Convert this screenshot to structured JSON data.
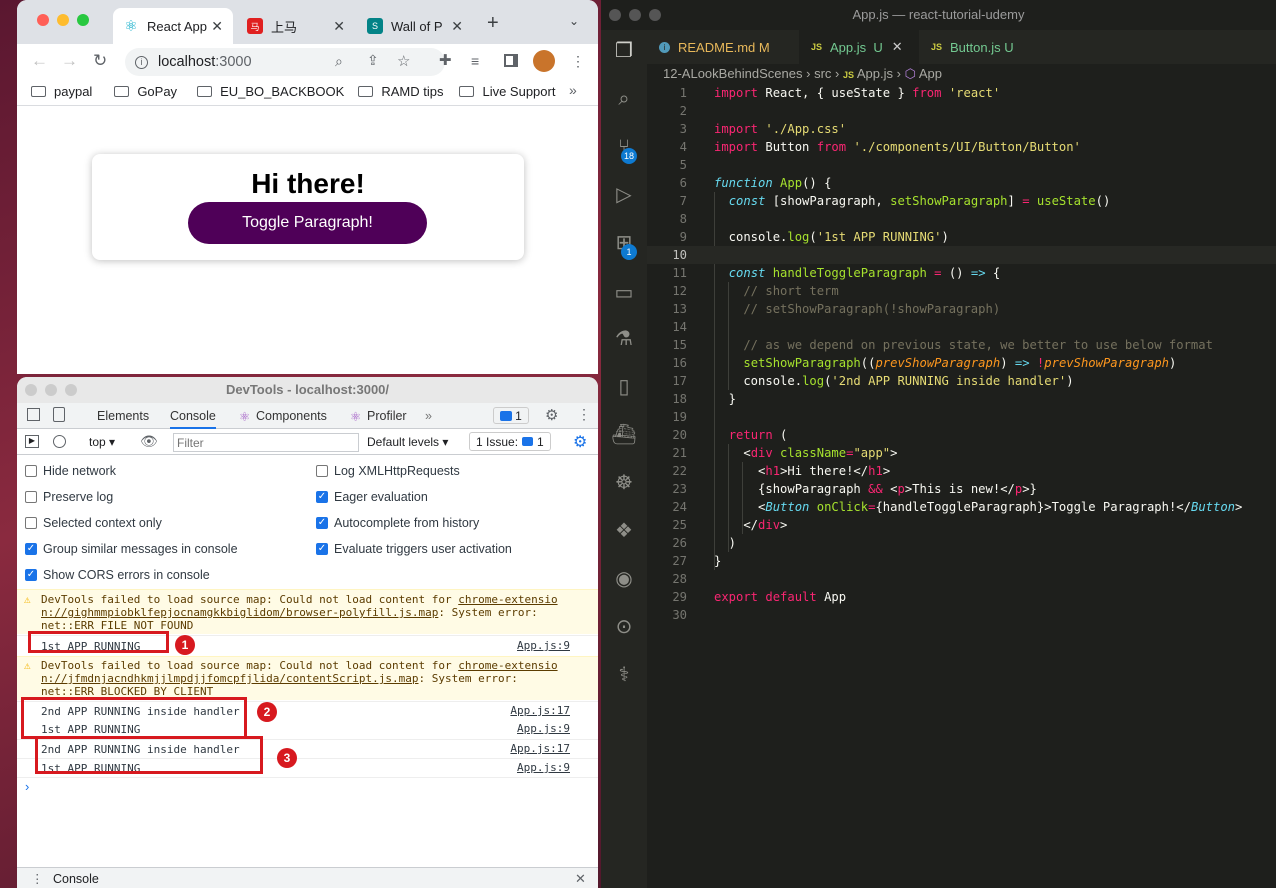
{
  "browser": {
    "tabs": [
      {
        "title": "React App",
        "active": true
      },
      {
        "title": "上马",
        "active": false
      },
      {
        "title": "Wall of Pr",
        "active": false
      }
    ],
    "url_host": "localhost",
    "url_port": ":3000",
    "bookmarks": [
      "paypal",
      "GoPay",
      "EU_BO_BACKBOOK",
      "RAMD tips",
      "Live Support"
    ],
    "page": {
      "heading": "Hi there!",
      "button_label": "Toggle Paragraph!"
    }
  },
  "devtools": {
    "title": "DevTools - localhost:3000/",
    "tabs": [
      "Elements",
      "Console",
      "Components",
      "Profiler"
    ],
    "messages_badge": "1",
    "context": "top",
    "filter_placeholder": "Filter",
    "levels": "Default levels",
    "issues": "1 Issue:",
    "issues_count": "1",
    "settings_left": [
      {
        "label": "Hide network",
        "checked": false
      },
      {
        "label": "Preserve log",
        "checked": false
      },
      {
        "label": "Selected context only",
        "checked": false
      },
      {
        "label": "Group similar messages in console",
        "checked": true
      },
      {
        "label": "Show CORS errors in console",
        "checked": true
      }
    ],
    "settings_right": [
      {
        "label": "Log XMLHttpRequests",
        "checked": false
      },
      {
        "label": "Eager evaluation",
        "checked": true
      },
      {
        "label": "Autocomplete from history",
        "checked": true
      },
      {
        "label": "Evaluate triggers user activation",
        "checked": true
      }
    ],
    "warn1": {
      "l1": "DevTools failed to load source map: Could not load content for ",
      "link1": "chrome-extensio",
      "link2": "n://gighmmpiobklfepjocnamgkkbiglidom/browser-polyfill.js.map",
      "rest": ": System error:",
      "l3": "net::ERR_FILE_NOT_FOUND"
    },
    "warn2": {
      "l1": "DevTools failed to load source map: Could not load content for ",
      "link1": "chrome-extensio",
      "link2": "n://jfmdnjacndhkmjjlmpdjjfomcpfjlida/contentScript.js.map",
      "rest": ": System error:",
      "l3": "net::ERR_BLOCKED_BY_CLIENT"
    },
    "logs": [
      {
        "text": "1st APP RUNNING",
        "src": "App.js:9"
      },
      {
        "text": "2nd APP RUNNING inside handler",
        "src": "App.js:17"
      },
      {
        "text": "1st APP RUNNING",
        "src": "App.js:9"
      },
      {
        "text": "2nd APP RUNNING inside handler",
        "src": "App.js:17"
      },
      {
        "text": "1st APP RUNNING",
        "src": "App.js:9"
      }
    ],
    "annotations": [
      "1",
      "2",
      "3"
    ],
    "drawer_label": "Console"
  },
  "vscode": {
    "title": "App.js — react-tutorial-udemy",
    "tabs": [
      {
        "name": "README.md",
        "status": "M"
      },
      {
        "name": "App.js",
        "status": "U"
      },
      {
        "name": "Button.js",
        "status": "U"
      }
    ],
    "breadcrumb": [
      "12-ALookBehindScenes",
      "src",
      "App.js",
      "App"
    ],
    "scm_badge": "18",
    "ext_badge": "1",
    "line_numbers": [
      "1",
      "2",
      "3",
      "4",
      "5",
      "6",
      "7",
      "8",
      "9",
      "10",
      "11",
      "12",
      "13",
      "14",
      "15",
      "16",
      "17",
      "18",
      "19",
      "20",
      "21",
      "22",
      "23",
      "24",
      "25",
      "26",
      "27",
      "28",
      "29",
      "30"
    ]
  }
}
